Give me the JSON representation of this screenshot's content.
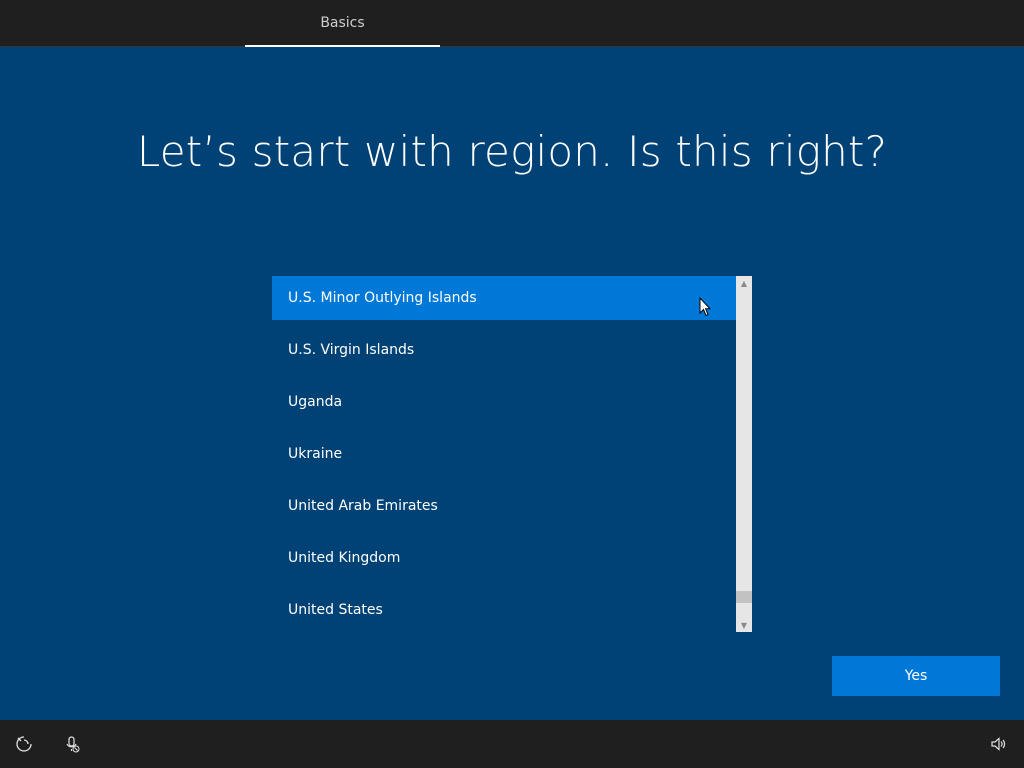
{
  "topbar": {
    "tab_label": "Basics"
  },
  "main": {
    "title": "Let’s start with region. Is this right?",
    "regions": [
      "U.S. Minor Outlying Islands",
      "U.S. Virgin Islands",
      "Uganda",
      "Ukraine",
      "United Arab Emirates",
      "United Kingdom",
      "United States"
    ],
    "selected_region": "U.S. Minor Outlying Islands",
    "yes_label": "Yes"
  },
  "bottombar": {
    "icons": [
      "ease-of-access-icon",
      "microphone-off-icon",
      "volume-icon"
    ]
  },
  "colors": {
    "background": "#004275",
    "accent": "#0078d7",
    "bar": "#1f1f1f"
  }
}
